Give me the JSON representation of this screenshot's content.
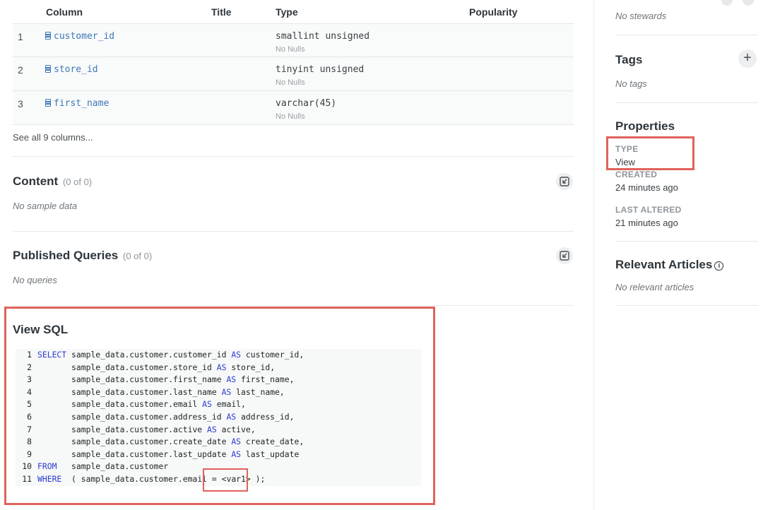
{
  "columns_table": {
    "headers": {
      "column": "Column",
      "title": "Title",
      "type": "Type",
      "popularity": "Popularity"
    },
    "rows": [
      {
        "index": "1",
        "name": "customer_id",
        "type": "smallint unsigned",
        "nulls": "No Nulls"
      },
      {
        "index": "2",
        "name": "store_id",
        "type": "tinyint unsigned",
        "nulls": "No Nulls"
      },
      {
        "index": "3",
        "name": "first_name",
        "type": "varchar(45)",
        "nulls": "No Nulls"
      }
    ],
    "see_all": "See all 9 columns..."
  },
  "content": {
    "title": "Content",
    "count": "(0 of 0)",
    "empty": "No sample data"
  },
  "published_queries": {
    "title": "Published Queries",
    "count": "(0 of 0)",
    "empty": "No queries"
  },
  "view_sql": {
    "title": "View SQL",
    "lines": [
      {
        "n": "1",
        "code": "SELECT sample_data.customer.customer_id AS customer_id,"
      },
      {
        "n": "2",
        "code": "       sample_data.customer.store_id AS store_id,"
      },
      {
        "n": "3",
        "code": "       sample_data.customer.first_name AS first_name,"
      },
      {
        "n": "4",
        "code": "       sample_data.customer.last_name AS last_name,"
      },
      {
        "n": "5",
        "code": "       sample_data.customer.email AS email,"
      },
      {
        "n": "6",
        "code": "       sample_data.customer.address_id AS address_id,"
      },
      {
        "n": "7",
        "code": "       sample_data.customer.active AS active,"
      },
      {
        "n": "8",
        "code": "       sample_data.customer.create_date AS create_date,"
      },
      {
        "n": "9",
        "code": "       sample_data.customer.last_update AS last_update"
      },
      {
        "n": "10",
        "code": "FROM   sample_data.customer"
      },
      {
        "n": "11",
        "code": "WHERE  ( sample_data.customer.email = <var1> );"
      }
    ],
    "keywords": [
      "SELECT",
      "AS",
      "FROM",
      "WHERE"
    ]
  },
  "sidebar": {
    "stewards_empty": "No stewards",
    "tags": {
      "title": "Tags",
      "empty": "No tags",
      "add_label": "+"
    },
    "properties": {
      "title": "Properties",
      "type_label": "TYPE",
      "type_value": "View",
      "created_label": "CREATED",
      "created_value": "24 minutes ago",
      "altered_label": "LAST ALTERED",
      "altered_value": "21 minutes ago"
    },
    "relevant_articles": {
      "title": "Relevant Articles",
      "info": "i",
      "empty": "No relevant articles"
    }
  },
  "colors": {
    "accent": "#3d78b8",
    "highlight": "#e0625a",
    "keyword": "#2b3bd1"
  }
}
